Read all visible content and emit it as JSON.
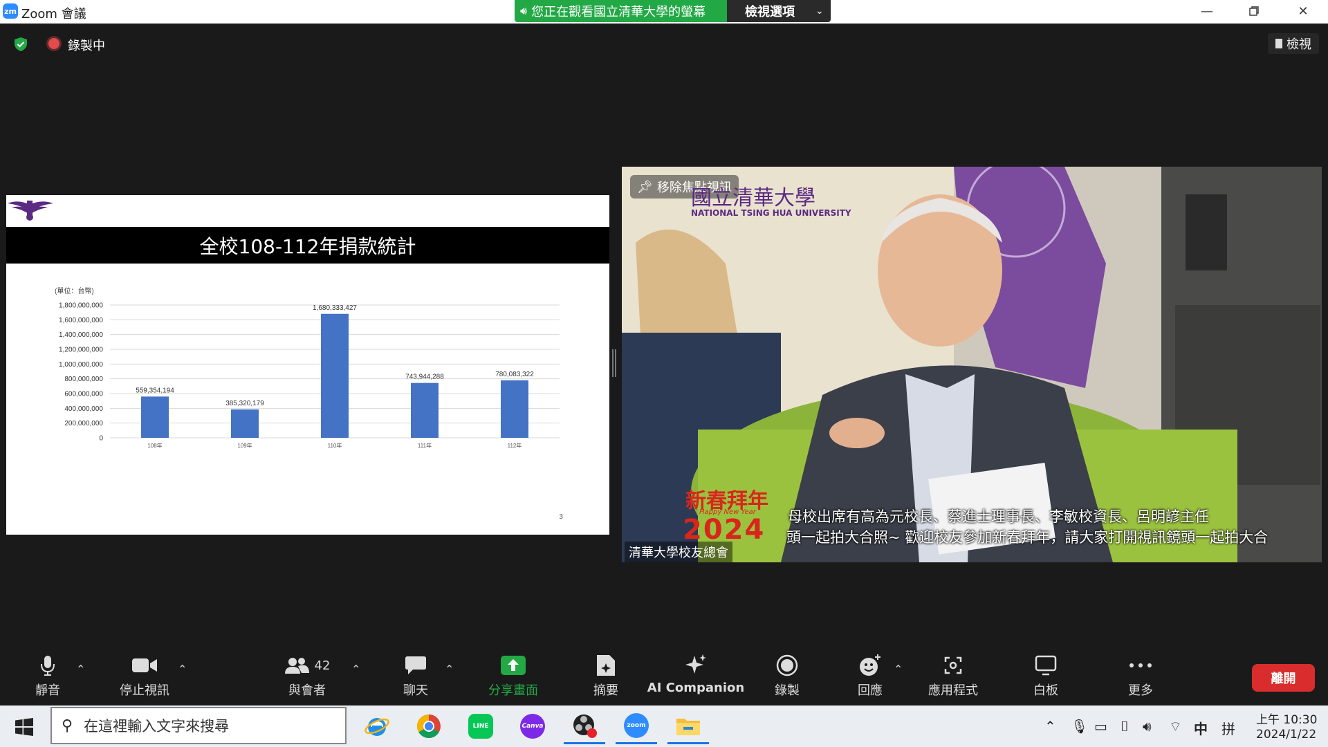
{
  "window": {
    "logo": "zm",
    "title": "Zoom 會議",
    "share_banner": "您正在觀看國立清華大學的螢幕",
    "view_options": "檢視選項",
    "controls": [
      "minimize-icon",
      "restore-icon",
      "close-icon"
    ]
  },
  "meeting_bar": {
    "recording_label": "錄製中",
    "view_button": "檢視",
    "shield_color": "#22a845"
  },
  "slide": {
    "title": "全校108-112年捐款統計",
    "page_number": "3"
  },
  "chart_data": {
    "type": "bar",
    "unit_label": "(單位：台幣)",
    "categories": [
      "108年",
      "109年",
      "110年",
      "111年",
      "112年"
    ],
    "values": [
      559354194,
      385320179,
      1680333427,
      743944288,
      780083322
    ],
    "value_labels": [
      "559,354,194",
      "385,320,179",
      "1,680,333,427",
      "743,944,288",
      "780,083,322"
    ],
    "yticks": [
      "0",
      "200,000,000",
      "400,000,000",
      "600,000,000",
      "800,000,000",
      "1,000,000,000",
      "1,200,000,000",
      "1,400,000,000",
      "1,600,000,000",
      "1,800,000,000"
    ],
    "ylim": [
      0,
      1800000000
    ],
    "grid": true,
    "bar_color": "#4472c4"
  },
  "video": {
    "unpin_label": "移除焦點視訊",
    "school_title": "國立清華大學",
    "school_subtitle": "NATIONAL TSING HUA UNIVERSITY",
    "cny_text": "新春拜年",
    "cny_hny": "Happy New Year",
    "cny_year": "2024",
    "ticker_line1": "母校出席有高為元校長、蔡進士理事長、李敏校資長、呂明諺主任",
    "ticker_line2": "頭一起拍大合照~ 歡迎校友參加新春拜年，請大家打開視訊鏡頭一起拍大合",
    "participant_name": "清華大學校友總會"
  },
  "toolbar": {
    "mute": "靜音",
    "stop_video": "停止視訊",
    "participants": "與會者",
    "participants_count": "42",
    "chat": "聊天",
    "share": "分享畫面",
    "summary": "摘要",
    "ai": "AI Companion",
    "record": "錄製",
    "reactions": "回應",
    "apps": "應用程式",
    "whiteboard": "白板",
    "more": "更多",
    "leave": "離開",
    "share_color": "#22a845",
    "leave_color": "#d92c2c"
  },
  "taskbar": {
    "search_placeholder": "在這裡輸入文字來搜尋",
    "apps": [
      "ie-icon",
      "chrome-icon",
      "line-icon",
      "canva-icon",
      "obs-icon",
      "zoom-icon",
      "file-explorer-icon"
    ],
    "line_label": "LINE",
    "canva_label": "Canva",
    "zoom_label": "zoom",
    "ime_mode": "中",
    "ime_layout": "拼",
    "time": "上午 10:30",
    "date": "2024/1/22"
  }
}
